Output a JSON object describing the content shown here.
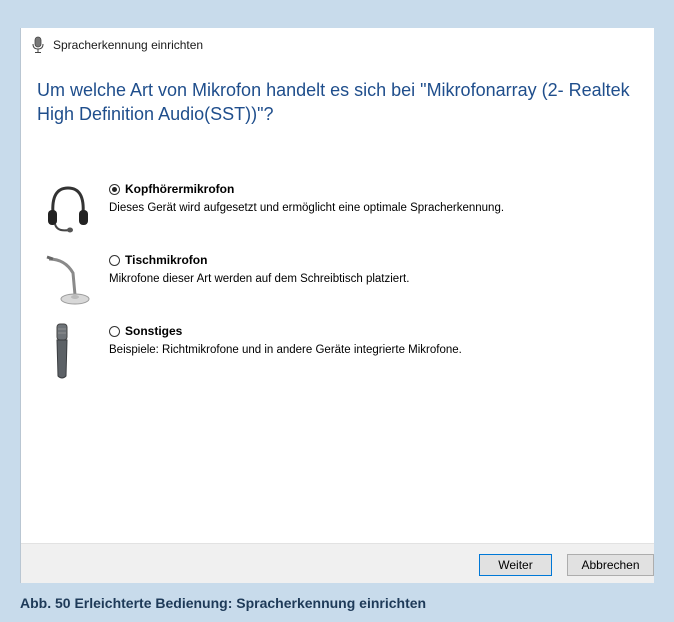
{
  "window": {
    "title": "Spracherkennung einrichten",
    "title_icon": "microphone-icon"
  },
  "heading": "Um welche Art von Mikrofon handelt es sich bei \"Mikrofonarray (2- Realtek High Definition Audio(SST))\"?",
  "options": [
    {
      "label": "Kopfhörermikrofon",
      "description": "Dieses Gerät wird aufgesetzt und ermöglicht eine optimale Spracherkennung.",
      "checked": true,
      "icon": "headset-icon"
    },
    {
      "label": "Tischmikrofon",
      "description": "Mikrofone dieser Art werden auf dem Schreibtisch platziert.",
      "checked": false,
      "icon": "desk-microphone-icon"
    },
    {
      "label": "Sonstiges",
      "description": "Beispiele: Richtmikrofone und in andere Geräte integrierte Mikrofone.",
      "checked": false,
      "icon": "handheld-microphone-icon"
    }
  ],
  "buttons": {
    "next": "Weiter",
    "cancel": "Abbrechen"
  },
  "caption": "Abb. 50 Erleichterte Bedienung: Spracherkennung einrichten",
  "colors": {
    "heading": "#1f4e8c",
    "background": "#c8dbeb",
    "caption": "#1e3a58"
  }
}
